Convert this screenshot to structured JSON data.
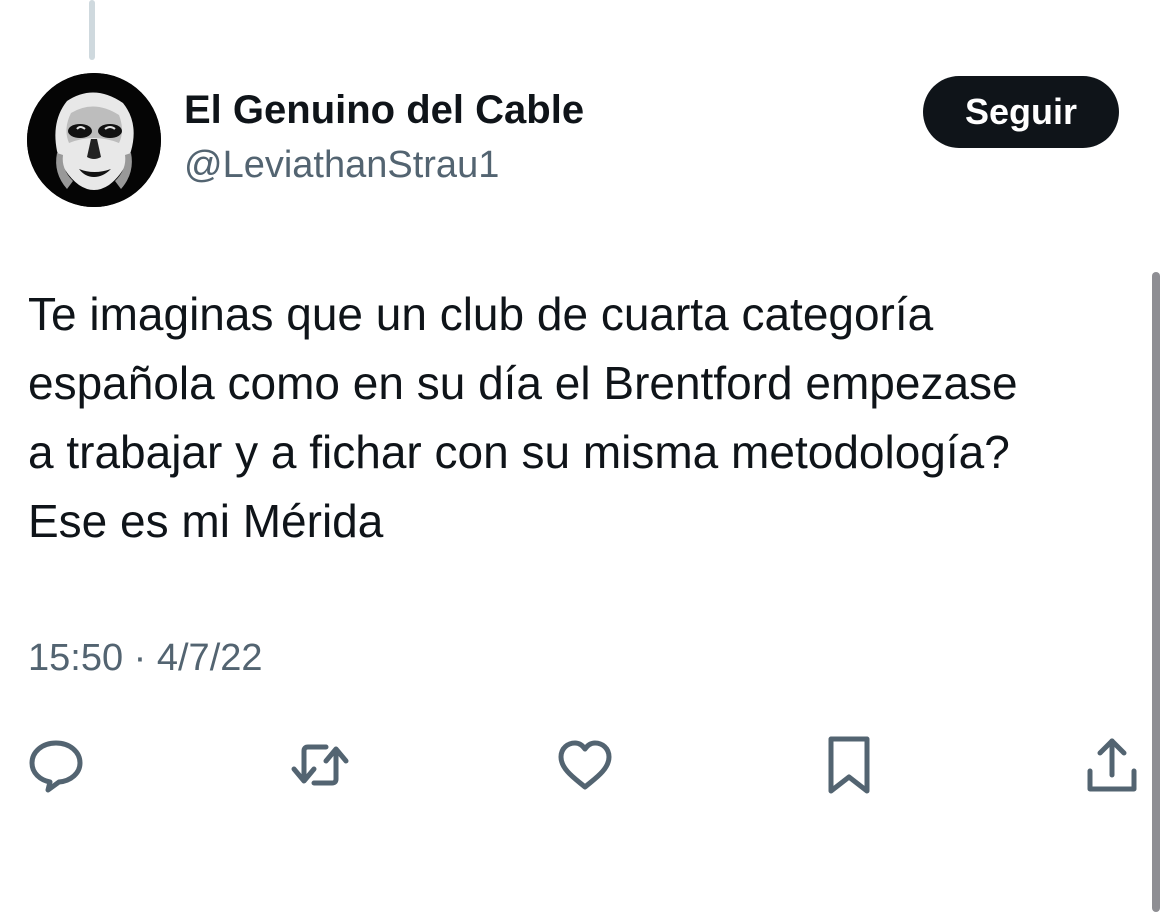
{
  "author": {
    "display_name": "El Genuino del Cable",
    "handle": "@LeviathanStrau1"
  },
  "follow_button": {
    "label": "Seguir"
  },
  "tweet": {
    "lines": [
      "Te imaginas que un club de cuarta categoría",
      "española como en su día el Brentford empezase",
      "a trabajar y a fichar con su misma metodología?",
      "Ese es mi Mérida"
    ],
    "timestamp": "15:50 · 4/7/22"
  },
  "actions": [
    {
      "icon": "reply-icon"
    },
    {
      "icon": "retweet-icon"
    },
    {
      "icon": "like-icon"
    },
    {
      "icon": "bookmark-icon"
    },
    {
      "icon": "share-icon"
    }
  ],
  "colors": {
    "text_primary": "#0f1419",
    "text_secondary": "#536471",
    "button_bg": "#0f1419",
    "button_text": "#ffffff",
    "thread_line": "#cfd9de"
  }
}
